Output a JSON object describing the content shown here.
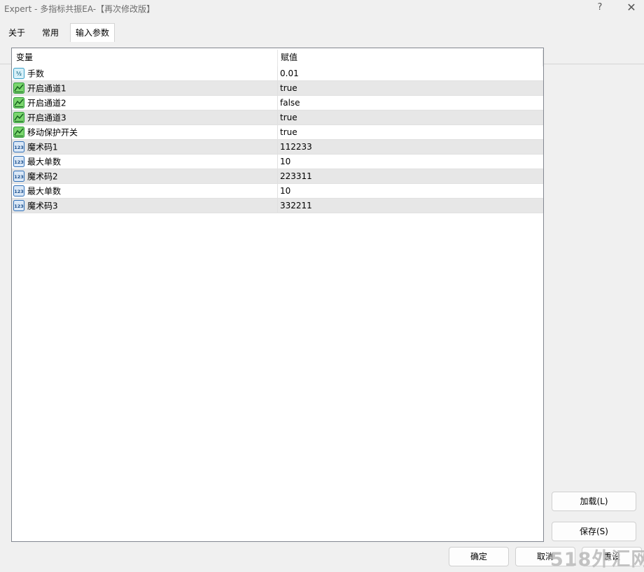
{
  "window": {
    "title": "Expert - 多指标共振EA-【再次修改版】",
    "help_glyph": "?",
    "close_glyph": "✕"
  },
  "tabs": [
    {
      "label": "关于",
      "active": false
    },
    {
      "label": "常用",
      "active": false
    },
    {
      "label": "输入参数",
      "active": true
    }
  ],
  "table": {
    "columns": {
      "variable": "变量",
      "value": "赋值"
    },
    "rows": [
      {
        "icon": "double-value-icon",
        "name": "手数",
        "value": "0.01"
      },
      {
        "icon": "boolean-chart-icon",
        "name": "开启通道1",
        "value": "true"
      },
      {
        "icon": "boolean-chart-icon",
        "name": "开启通道2",
        "value": "false"
      },
      {
        "icon": "boolean-chart-icon",
        "name": "开启通道3",
        "value": "true"
      },
      {
        "icon": "boolean-chart-icon",
        "name": "移动保护开关",
        "value": "true"
      },
      {
        "icon": "integer-123-icon",
        "name": "魔术码1",
        "value": "112233"
      },
      {
        "icon": "integer-123-icon",
        "name": "最大单数",
        "value": "10"
      },
      {
        "icon": "integer-123-icon",
        "name": "魔术码2",
        "value": "223311"
      },
      {
        "icon": "integer-123-icon",
        "name": "最大单数",
        "value": "10"
      },
      {
        "icon": "integer-123-icon",
        "name": "魔术码3",
        "value": "332211"
      }
    ]
  },
  "buttons": {
    "load": "加载(L)",
    "save": "保存(S)",
    "ok": "确定",
    "cancel": "取消",
    "reset": "重设"
  },
  "watermark": "518外汇网",
  "colors": {
    "accent_bool": "#3cb043",
    "accent_int": "#2e6fb8",
    "accent_double": "#3aa0c8"
  }
}
